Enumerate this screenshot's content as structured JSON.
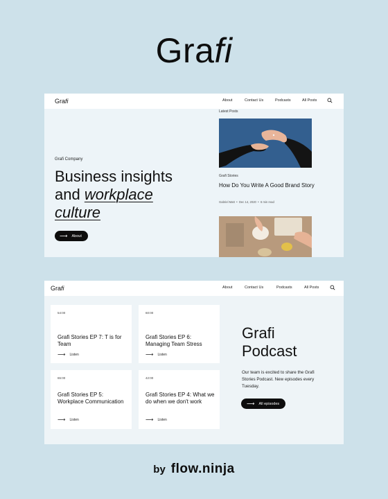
{
  "brand": {
    "logo_main": "Gra",
    "logo_italic": "fi"
  },
  "nav": {
    "logo_main": "Gra",
    "logo_italic": "fi",
    "links": [
      "About",
      "Contact Us",
      "Podcasts",
      "All Posts"
    ],
    "search_icon": "search-icon"
  },
  "hero": {
    "eyebrow": "Grafi Company",
    "title_line1": "Business insights",
    "title_line2_plain": "and ",
    "title_line2_em": "workplace",
    "title_line3_em": "culture",
    "button_label": "About"
  },
  "latest": {
    "label": "Latest Posts",
    "post": {
      "category": "Grafi Stories",
      "title": "How Do You Write A Good Brand Story",
      "author": "Gabriel Matt",
      "date": "Dec 14, 2020",
      "read_time": "6 min read"
    }
  },
  "podcast": {
    "title_line1": "Grafi",
    "title_line2": "Podcast",
    "description": "Our team is excited to share the Grafi Stories Podcast. New episodes every Tuesday.",
    "button_label": "All episodes",
    "listen_label": "Listen",
    "episodes": [
      {
        "duration": "54:00",
        "title": "Grafi Stories EP 7: T is for Team"
      },
      {
        "duration": "60:00",
        "title": "Grafi Stories EP 6: Managing Team Stress"
      },
      {
        "duration": "65:00",
        "title": "Grafi Stories EP 5: Workplace Communication"
      },
      {
        "duration": "42:00",
        "title": "Grafi Stories EP 4: What we do when we don't work"
      }
    ]
  },
  "footer": {
    "by": "by",
    "brand": "flow.ninja"
  },
  "colors": {
    "background": "#cde1ea",
    "panel": "#edf4f8",
    "accent": "#0d0d0d"
  }
}
